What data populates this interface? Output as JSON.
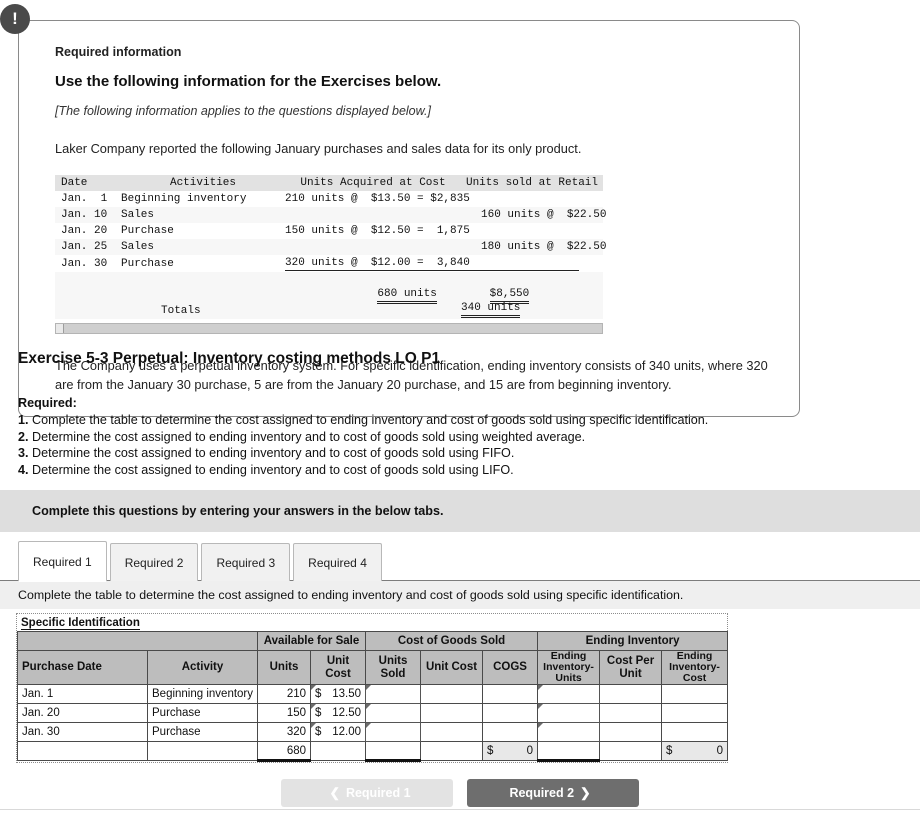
{
  "callout": {
    "badge_icon": "exclamation-icon",
    "required_information_label": "Required information",
    "heading": "Use the following information for the Exercises below.",
    "italic_note": "[The following information applies to the questions displayed below.]",
    "intro": "Laker Company reported the following January purchases and sales data for its only product.",
    "footer": "The Company uses a perpetual inventory system. For specific identification, ending inventory consists of 340 units, where 320 are from the January 30 purchase, 5 are from the January 20 purchase, and 15 are from beginning inventory."
  },
  "mono_table": {
    "headers": {
      "date": "Date",
      "activities": "Activities",
      "acquired": "Units Acquired at Cost",
      "sold": "Units sold at Retail"
    },
    "rows": [
      {
        "date": "Jan.  1",
        "activity": "Beginning inventory",
        "acquired": "210 units @  $13.50 = $2,835",
        "sold": ""
      },
      {
        "date": "Jan. 10",
        "activity": "Sales",
        "acquired": "",
        "sold": "160 units @  $22.50"
      },
      {
        "date": "Jan. 20",
        "activity": "Purchase",
        "acquired": "150 units @  $12.50 =  1,875",
        "sold": ""
      },
      {
        "date": "Jan. 25",
        "activity": "Sales",
        "acquired": "",
        "sold": "180 units @  $22.50"
      },
      {
        "date": "Jan. 30",
        "activity": "Purchase",
        "acquired": "320 units @  $12.00 =  3,840",
        "sold": ""
      }
    ],
    "totals": {
      "label": "Totals",
      "units": "680 units",
      "cost": "$8,550",
      "sold": "340 units"
    }
  },
  "exercise": {
    "title": "Exercise 5-3 Perpetual: Inventory costing methods LO P1",
    "required_label": "Required:",
    "items": [
      {
        "num": "1.",
        "text": "Complete the table to determine the cost assigned to ending inventory and cost of goods sold using specific identification."
      },
      {
        "num": "2.",
        "text": "Determine the cost assigned to ending inventory and to cost of goods sold using weighted average."
      },
      {
        "num": "3.",
        "text": "Determine the cost assigned to ending inventory and to cost of goods sold using FIFO."
      },
      {
        "num": "4.",
        "text": "Determine the cost assigned to ending inventory and to cost of goods sold using LIFO."
      }
    ]
  },
  "instruction_bar": {
    "text": "Complete this questions by entering your answers in the below tabs."
  },
  "tabs": {
    "items": [
      {
        "label": "Required 1",
        "active": true
      },
      {
        "label": "Required 2",
        "active": false
      },
      {
        "label": "Required 3",
        "active": false
      },
      {
        "label": "Required 4",
        "active": false
      }
    ],
    "active_description": "Complete the table to determine the cost assigned to ending inventory and cost of goods sold using specific identification."
  },
  "sheet": {
    "title": "Specific Identification",
    "group_headers": {
      "available": "Available for Sale",
      "cogs": "Cost of Goods Sold",
      "ending": "Ending Inventory"
    },
    "columns": {
      "purchase_date": "Purchase Date",
      "activity": "Activity",
      "units": "Units",
      "unit_cost": "Unit\nCost",
      "units_sold": "Units\nSold",
      "cogs_unit_cost": "Unit Cost",
      "cogs": "COGS",
      "ei_units": "Ending\nInventory-\nUnits",
      "cost_per_unit": "Cost Per\nUnit",
      "ei_cost": "Ending\nInventory-\nCost"
    },
    "rows": [
      {
        "purchase_date": "Jan. 1",
        "activity": "Beginning inventory",
        "units": "210",
        "unit_cost_symbol": "$",
        "unit_cost_value": "13.50",
        "units_sold": "",
        "cogs_unit_cost": "",
        "cogs": "",
        "ei_units": "",
        "cost_per_unit": "",
        "ei_cost": ""
      },
      {
        "purchase_date": "Jan. 20",
        "activity": "Purchase",
        "units": "150",
        "unit_cost_symbol": "$",
        "unit_cost_value": "12.50",
        "units_sold": "",
        "cogs_unit_cost": "",
        "cogs": "",
        "ei_units": "",
        "cost_per_unit": "",
        "ei_cost": ""
      },
      {
        "purchase_date": "Jan. 30",
        "activity": "Purchase",
        "units": "320",
        "unit_cost_symbol": "$",
        "unit_cost_value": "12.00",
        "units_sold": "",
        "cogs_unit_cost": "",
        "cogs": "",
        "ei_units": "",
        "cost_per_unit": "",
        "ei_cost": ""
      }
    ],
    "total_row": {
      "purchase_date": "",
      "activity": "",
      "units": "680",
      "unit_cost": "",
      "units_sold": "",
      "cogs_unit_cost": "",
      "cogs_symbol": "$",
      "cogs_value": "0",
      "ei_units": "",
      "cost_per_unit": "",
      "ei_cost_symbol": "$",
      "ei_cost_value": "0"
    }
  },
  "nav": {
    "prev_label": "Required 1",
    "prev_icon": "chevron-left-icon",
    "next_label": "Required 2",
    "next_icon": "chevron-right-icon"
  },
  "colors": {
    "badge": "#4a4a4a",
    "instruction_bar": "#dedede",
    "next_button": "#6e6e6e",
    "prev_button": "#e3e3e3",
    "sheet_header": "#bdbdbd"
  }
}
